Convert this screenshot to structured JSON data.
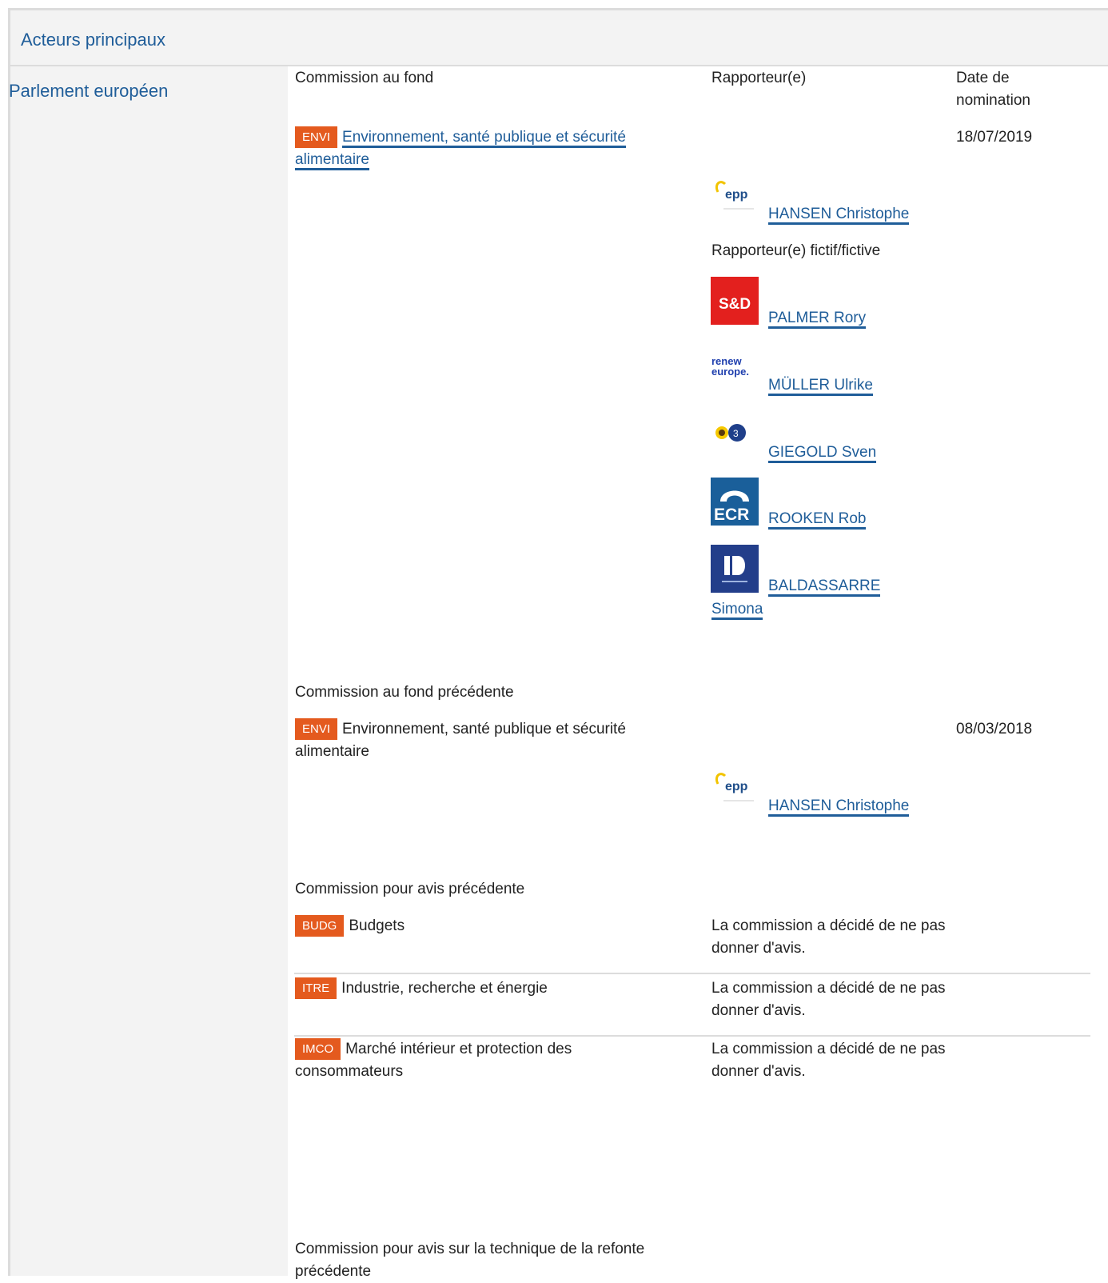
{
  "header": {
    "title": "Acteurs principaux"
  },
  "institution": "Parlement européen",
  "columns": {
    "committee": "Commission au fond",
    "rapporteur": "Rapporteur(e)",
    "date": "Date de nomination"
  },
  "lead_committee": {
    "code": "ENVI",
    "name": "Environnement, santé publique et sécurité alimentaire",
    "date": "18/07/2019",
    "rapporteur": {
      "name": "HANSEN Christophe",
      "group_icon": "epp-logo-icon"
    },
    "shadow_label": "Rapporteur(e) fictif/fictive",
    "shadows": [
      {
        "name": "PALMER Rory",
        "group_icon": "sd-logo-icon",
        "logo_text": "S&D"
      },
      {
        "name": "MÜLLER Ulrike",
        "group_icon": "renew-europe-logo-icon",
        "logo_text": "renew europe."
      },
      {
        "name": "GIEGOLD Sven",
        "group_icon": "greens-efa-logo-icon"
      },
      {
        "name": "ROOKEN Rob",
        "group_icon": "ecr-logo-icon",
        "logo_text": "ECR"
      },
      {
        "name_line1": "BALDASSARRE",
        "name_line2": "Simona",
        "group_icon": "id-logo-icon"
      }
    ]
  },
  "previous_lead": {
    "label": "Commission au fond précédente",
    "code": "ENVI",
    "name": "Environnement, santé publique et sécurité alimentaire",
    "date": "08/03/2018",
    "rapporteur": {
      "name": "HANSEN Christophe",
      "group_icon": "epp-logo-icon"
    }
  },
  "previous_opinion": {
    "label": "Commission pour avis précédente",
    "committees": [
      {
        "code": "BUDG",
        "name": "Budgets",
        "status": "La commission a décidé de ne pas donner d'avis."
      },
      {
        "code": "ITRE",
        "name": "Industrie, recherche et énergie",
        "status": "La commission a décidé de ne pas donner d'avis."
      },
      {
        "code": "IMCO",
        "name": "Marché intérieur et protection des consommateurs",
        "status": "La commission a décidé de ne pas donner d'avis."
      }
    ]
  },
  "recast": {
    "label": "Commission pour avis sur la technique de la refonte précédente"
  },
  "colors": {
    "accent": "#1f5d99",
    "tag": "#e45a1e",
    "panel_bg": "#f3f3f3",
    "border": "#dcdcdc"
  }
}
